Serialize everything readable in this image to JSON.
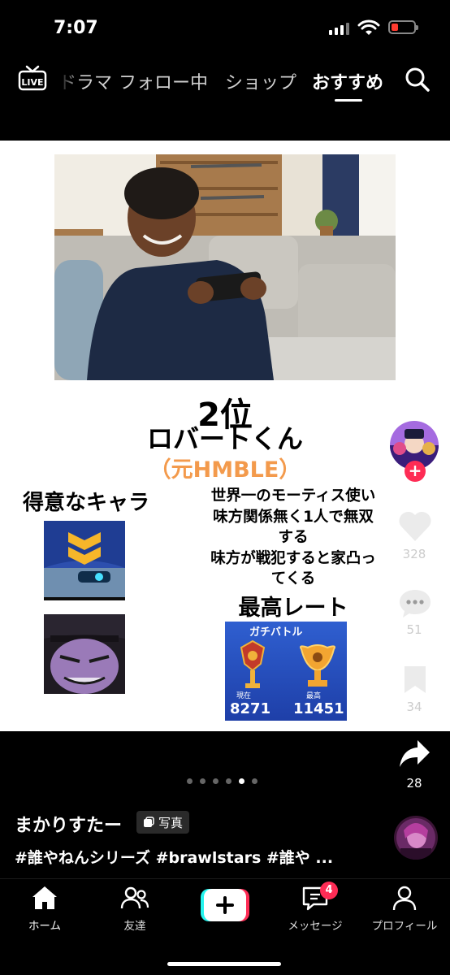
{
  "status": {
    "time": "7:07"
  },
  "top_nav": {
    "live": "LIVE",
    "items": [
      "ドラマ",
      "フォロー中",
      "ショップ",
      "おすすめ"
    ],
    "active": "おすすめ"
  },
  "post": {
    "rank": "2位",
    "name": "ロバートくん",
    "former": "（元HMBLE）",
    "fav_label": "得意なキャラ",
    "desc_lines": [
      "世界一のモーティス使い",
      "味方関係無く1人で無双",
      "する",
      "味方が戦犯すると家凸っ",
      "てくる"
    ],
    "best_label": "最高レート",
    "rank_card": {
      "title": "ガチバトル",
      "current_label": "現在",
      "current_value": "8271",
      "best_label": "最高",
      "best_value": "11451"
    }
  },
  "actions": {
    "likes": "328",
    "comments": "51",
    "saves": "34",
    "shares": "28"
  },
  "carousel": {
    "count": 6,
    "active": 4
  },
  "caption": {
    "author": "まかりすたー",
    "tag": "写真",
    "hashtags": "#誰やねんシリーズ #brawlstars #誰や ..."
  },
  "bottom_nav": {
    "home": "ホーム",
    "friends": "友達",
    "create": "+",
    "messages": "メッセージ",
    "messages_badge": "4",
    "profile": "プロフィール"
  },
  "colors": {
    "accent": "#fe2c55",
    "cyan": "#25f4ee",
    "orange": "#f39a4c"
  }
}
